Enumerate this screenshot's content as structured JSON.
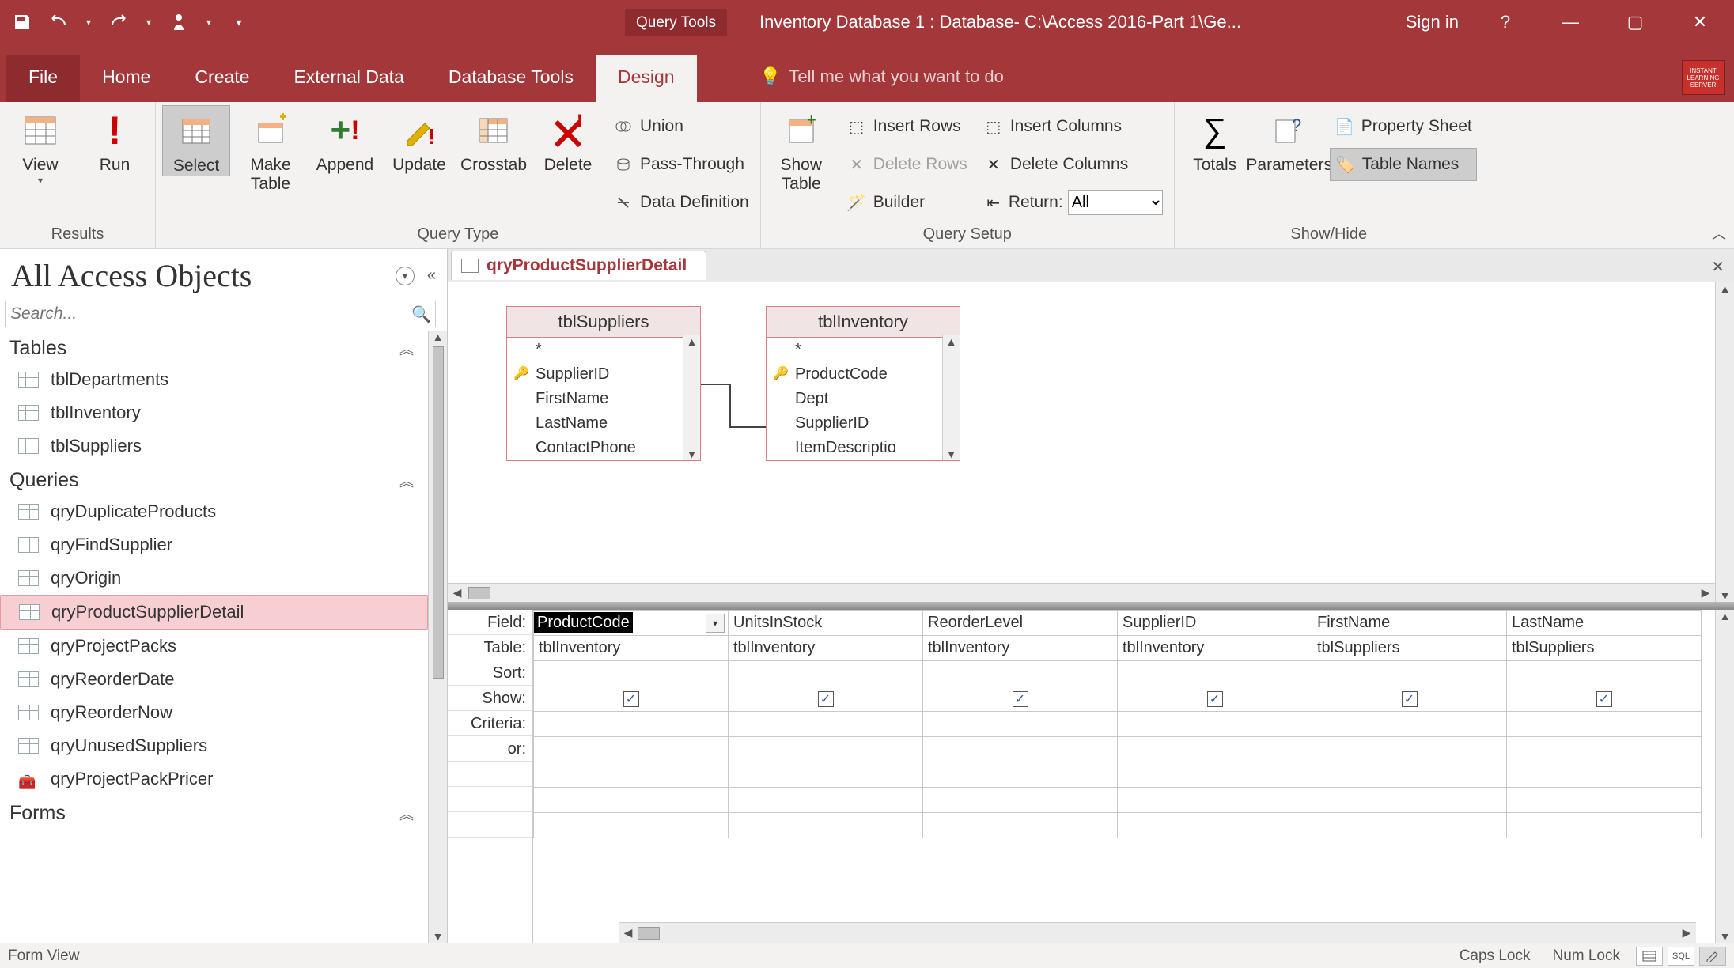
{
  "titlebar": {
    "query_tools": "Query Tools",
    "window_title": "Inventory Database 1 : Database- C:\\Access 2016-Part 1\\Ge...",
    "sign_in": "Sign in",
    "badge": "INSTANT LEARNING SERVER"
  },
  "tabs": {
    "file": "File",
    "home": "Home",
    "create": "Create",
    "external_data": "External Data",
    "database_tools": "Database Tools",
    "design": "Design",
    "tell_me_placeholder": "Tell me what you want to do"
  },
  "ribbon": {
    "results": {
      "label": "Results",
      "view": "View",
      "run": "Run"
    },
    "query_type": {
      "label": "Query Type",
      "select": "Select",
      "make_table": "Make\nTable",
      "append": "Append",
      "update": "Update",
      "crosstab": "Crosstab",
      "delete": "Delete",
      "union": "Union",
      "pass_through": "Pass-Through",
      "data_definition": "Data Definition"
    },
    "query_setup": {
      "label": "Query Setup",
      "show_table": "Show\nTable",
      "insert_rows": "Insert Rows",
      "delete_rows": "Delete Rows",
      "builder": "Builder",
      "insert_columns": "Insert Columns",
      "delete_columns": "Delete Columns",
      "return": "Return:",
      "return_value": "All"
    },
    "show_hide": {
      "label": "Show/Hide",
      "totals": "Totals",
      "parameters": "Parameters",
      "property_sheet": "Property Sheet",
      "table_names": "Table Names"
    }
  },
  "nav": {
    "title": "All Access Objects",
    "search_placeholder": "Search...",
    "groups": {
      "tables": {
        "label": "Tables",
        "items": [
          "tblDepartments",
          "tblInventory",
          "tblSuppliers"
        ]
      },
      "queries": {
        "label": "Queries",
        "items": [
          "qryDuplicateProducts",
          "qryFindSupplier",
          "qryOrigin",
          "qryProductSupplierDetail",
          "qryProjectPacks",
          "qryReorderDate",
          "qryReorderNow",
          "qryUnusedSuppliers",
          "qryProjectPackPricer"
        ],
        "selected_index": 3
      },
      "forms": {
        "label": "Forms"
      }
    }
  },
  "doc": {
    "tab_name": "qryProductSupplierDetail",
    "tables": {
      "suppliers": {
        "title": "tblSuppliers",
        "fields": [
          "*",
          "SupplierID",
          "FirstName",
          "LastName",
          "ContactPhone"
        ],
        "pk_index": 1
      },
      "inventory": {
        "title": "tblInventory",
        "fields": [
          "*",
          "ProductCode",
          "Dept",
          "SupplierID",
          "ItemDescriptio"
        ],
        "pk_index": 1
      }
    }
  },
  "qbe": {
    "rows": {
      "field": "Field:",
      "table": "Table:",
      "sort": "Sort:",
      "show": "Show:",
      "criteria": "Criteria:",
      "or": "or:"
    },
    "cols": [
      {
        "field": "ProductCode",
        "table": "tblInventory",
        "show": true,
        "active": true
      },
      {
        "field": "UnitsInStock",
        "table": "tblInventory",
        "show": true
      },
      {
        "field": "ReorderLevel",
        "table": "tblInventory",
        "show": true
      },
      {
        "field": "SupplierID",
        "table": "tblInventory",
        "show": true
      },
      {
        "field": "FirstName",
        "table": "tblSuppliers",
        "show": true
      },
      {
        "field": "LastName",
        "table": "tblSuppliers",
        "show": true
      }
    ]
  },
  "statusbar": {
    "left": "Form View",
    "caps": "Caps Lock",
    "num": "Num Lock",
    "views": {
      "datasheet": "≡",
      "sql": "SQL",
      "design": "✎"
    }
  }
}
